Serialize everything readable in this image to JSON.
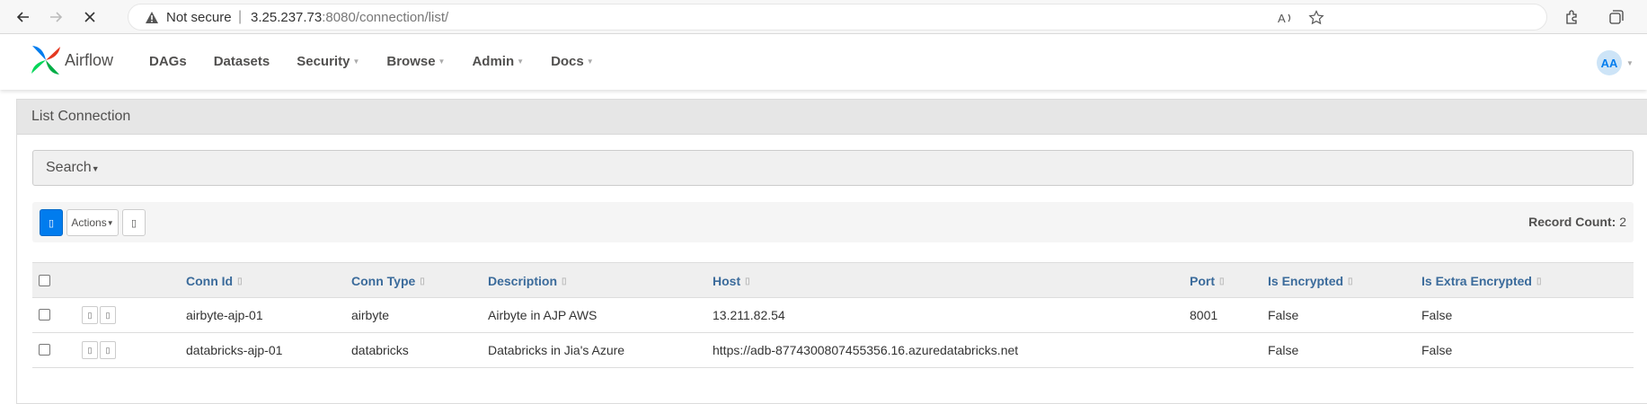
{
  "browser": {
    "not_secure": "Not secure",
    "url_host": "3.25.237.73",
    "url_rest": ":8080/connection/list/"
  },
  "app": {
    "brand": "Airflow",
    "menu": [
      {
        "label": "DAGs",
        "caret": false
      },
      {
        "label": "Datasets",
        "caret": false
      },
      {
        "label": "Security",
        "caret": true
      },
      {
        "label": "Browse",
        "caret": true
      },
      {
        "label": "Admin",
        "caret": true
      },
      {
        "label": "Docs",
        "caret": true
      }
    ],
    "avatar": "AA"
  },
  "panel": {
    "title": "List Connection",
    "search_label": "Search",
    "actions_label": "Actions",
    "record_count_label": "Record Count:",
    "record_count": "2"
  },
  "table": {
    "columns": [
      "Conn Id",
      "Conn Type",
      "Description",
      "Host",
      "Port",
      "Is Encrypted",
      "Is Extra Encrypted"
    ],
    "rows": [
      {
        "conn_id": "airbyte-ajp-01",
        "conn_type": "airbyte",
        "description": "Airbyte in AJP AWS",
        "host": "13.211.82.54",
        "port": "8001",
        "is_encrypted": "False",
        "is_extra_encrypted": "False"
      },
      {
        "conn_id": "databricks-ajp-01",
        "conn_type": "databricks",
        "description": "Databricks in Jia's Azure",
        "host": "https://adb-8774300807455356.16.azuredatabricks.net",
        "port": "",
        "is_encrypted": "False",
        "is_extra_encrypted": "False"
      }
    ]
  },
  "icons": {
    "glyph": "▯"
  }
}
